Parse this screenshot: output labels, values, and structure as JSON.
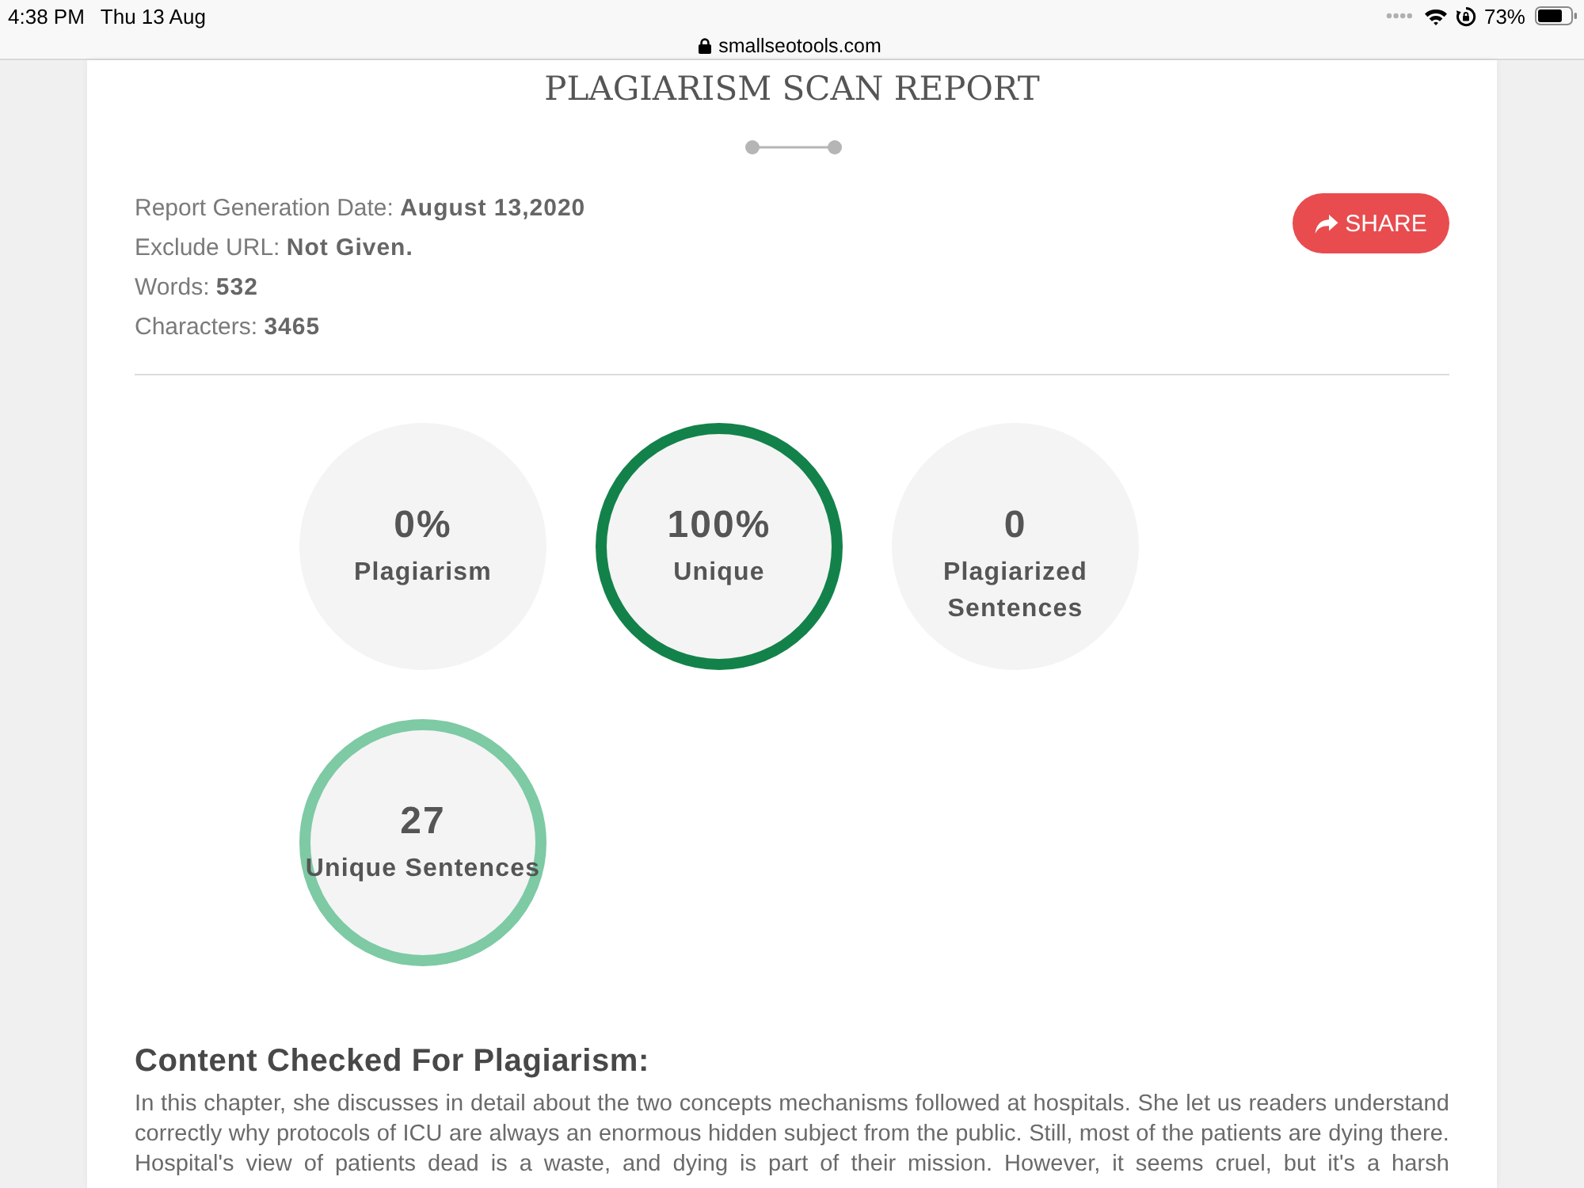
{
  "status_bar": {
    "time": "4:38 PM",
    "date": "Thu 13 Aug",
    "battery": "73%"
  },
  "address_bar": {
    "url": "smallseotools.com"
  },
  "report": {
    "title": "PLAGIARISM SCAN REPORT",
    "share_button": "SHARE",
    "details": [
      {
        "label": "Report Generation Date:",
        "value": "August 13,2020"
      },
      {
        "label": "Exclude URL:",
        "value": "Not Given."
      },
      {
        "label": "Words:",
        "value": "532"
      },
      {
        "label": "Characters:",
        "value": "3465"
      }
    ],
    "stats": [
      {
        "kind": "plain",
        "value": "0%",
        "label": "Plagiarism"
      },
      {
        "kind": "ring",
        "color": "#13824a",
        "value": "100%",
        "label": "Unique"
      },
      {
        "kind": "plain",
        "value": "0",
        "label": "Plagiarized Sentences"
      },
      {
        "kind": "ring",
        "color": "#7dcaa4",
        "value": "27",
        "label": "Unique Sentences"
      }
    ]
  },
  "content": {
    "heading": "Content Checked For Plagiarism:",
    "text": "In this chapter, she discusses in detail about the two concepts mechanisms followed at hospitals. She let us readers understand correctly why protocols of ICU are always an enormous hidden subject from the public. Still, most of the patients are dying there. Hospital's view of patients dead is a waste, and dying is part of their mission. However, it seems cruel, but it's a harsh"
  }
}
